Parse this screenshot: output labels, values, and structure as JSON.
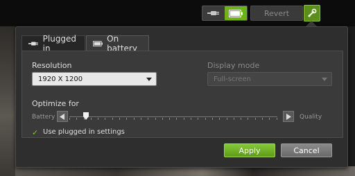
{
  "toolbar": {
    "revert_label": "Revert",
    "power_icons": [
      "plug-icon",
      "battery-icon"
    ],
    "active_power_mode": "battery",
    "wrench_icon": "wrench-icon"
  },
  "tabs": [
    {
      "label": "Plugged in",
      "icon": "plug-icon",
      "selected": false
    },
    {
      "label": "On battery",
      "icon": "battery-icon",
      "selected": true
    }
  ],
  "resolution": {
    "label": "Resolution",
    "value": "1920 X 1200"
  },
  "display_mode": {
    "label": "Display mode",
    "value": "Full-screen",
    "enabled": false
  },
  "optimize": {
    "label": "Optimize for",
    "min_label": "Battery",
    "max_label": "Quality",
    "tick_count": 30,
    "position_fraction": 0.08
  },
  "plugged_setting": {
    "label": "Use plugged in settings",
    "checked": true
  },
  "actions": {
    "apply_label": "Apply",
    "cancel_label": "Cancel"
  },
  "colors": {
    "accent": "#6cb21c",
    "panel": "#2e2e2e"
  }
}
